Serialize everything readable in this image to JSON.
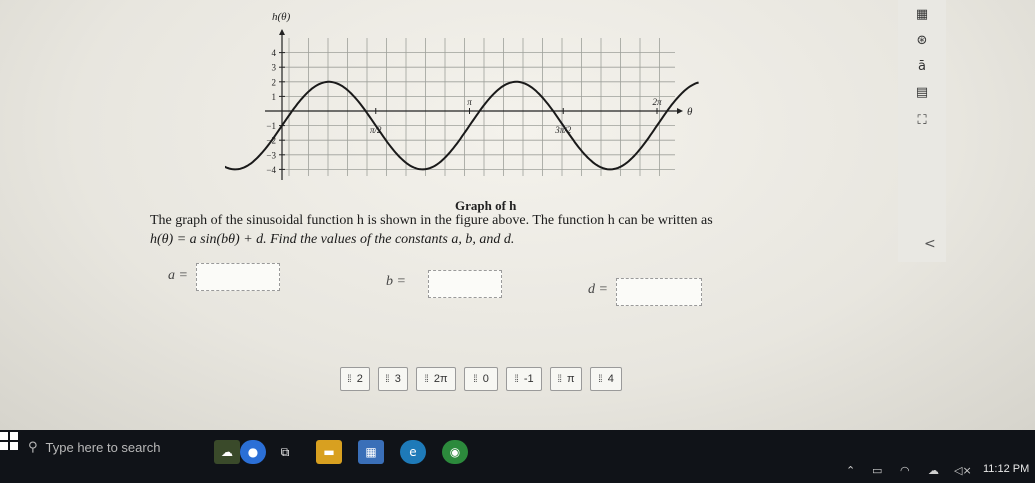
{
  "graph": {
    "title": "h(θ)",
    "caption": "Graph of h",
    "chart_data": {
      "type": "line",
      "ylabel": "h(θ)",
      "xlabel": "θ",
      "y_ticks": [
        "4",
        "3",
        "2",
        "1",
        "−1",
        "−2",
        "−3",
        "−4"
      ],
      "x_ticks": [
        {
          "label": "π/2",
          "value": 1.5708
        },
        {
          "label": "π",
          "value": 3.1416
        },
        {
          "label": "3π/2",
          "value": 4.7124
        },
        {
          "label": "2π",
          "value": 6.2832
        }
      ],
      "ylim": [
        -4.5,
        4.5
      ],
      "xlim": [
        -1.3,
        7.0
      ],
      "series": [
        {
          "function": "h(θ) = 3 sin(2θ) − 1",
          "amplitude": 3,
          "frequency": 2,
          "vertical_shift": -1
        }
      ]
    }
  },
  "problem": {
    "line1": "The graph of the sinusoidal function h is shown in the figure above. The function h can be written as",
    "line2": "h(θ) = a sin(bθ) + d. Find the values of the constants  a, b, and d."
  },
  "answers": {
    "a_label": "a =",
    "b_label": "b =",
    "d_label": "d ="
  },
  "tiles": [
    "2",
    "3",
    "2π",
    "0",
    "-1",
    "π",
    "4"
  ],
  "sidebar": {
    "icons": [
      "grid-icon",
      "accessibility-icon",
      "text-size-icon",
      "notes-icon",
      "fullscreen-icon"
    ],
    "collapse": "<"
  },
  "taskbar": {
    "search_placeholder": "Type here to search",
    "time": "11:12 PM"
  }
}
